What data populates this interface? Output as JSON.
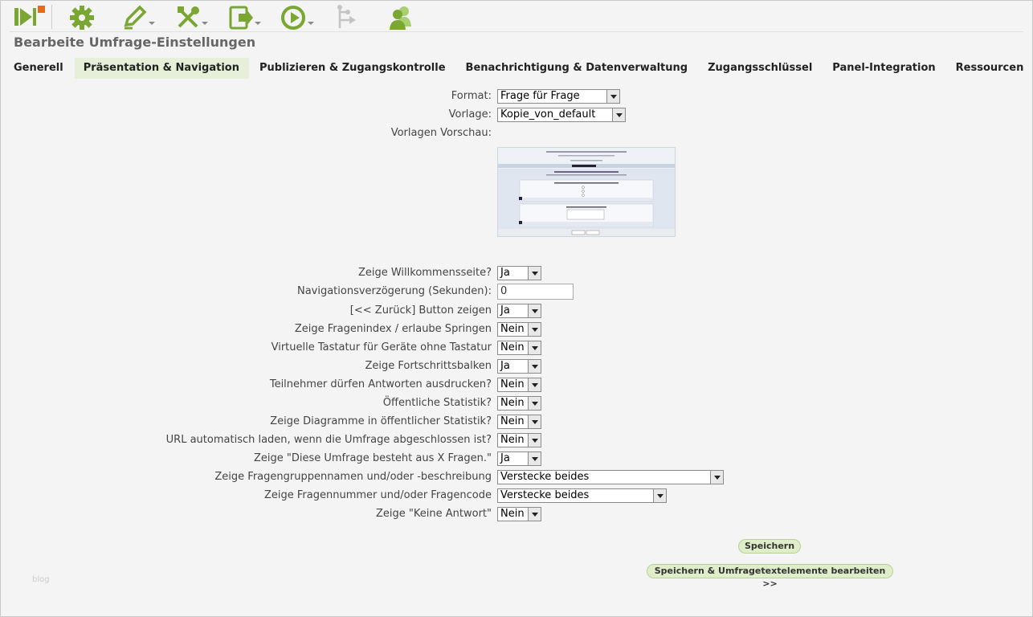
{
  "toolbar": {
    "items": [
      "limesurvey-logo-icon",
      "settings-gear-icon",
      "edit-pencil-icon",
      "tools-icon",
      "import-export-icon",
      "activate-icon",
      "survey-structure-icon",
      "participants-icon"
    ]
  },
  "page_title": "Bearbeite Umfrage-Einstellungen",
  "tabs": [
    {
      "label": "Generell"
    },
    {
      "label": "Präsentation & Navigation"
    },
    {
      "label": "Publizieren & Zugangskontrolle"
    },
    {
      "label": "Benachrichtigung & Datenverwaltung"
    },
    {
      "label": "Zugangsschlüssel"
    },
    {
      "label": "Panel-Integration"
    },
    {
      "label": "Ressourcen"
    }
  ],
  "form": {
    "format": {
      "label": "Format:",
      "value": "Frage für Frage"
    },
    "vorlage": {
      "label": "Vorlage:",
      "value": "Kopie_von_default"
    },
    "vorschau": {
      "label": "Vorlagen Vorschau:"
    },
    "welcome": {
      "label": "Zeige Willkommensseite?",
      "value": "Ja"
    },
    "navdelay": {
      "label": "Navigationsverzögerung (Sekunden):",
      "value": "0"
    },
    "backbutton": {
      "label": "[<< Zurück] Button zeigen",
      "value": "Ja"
    },
    "qindex": {
      "label": "Zeige Fragenindex / erlaube Springen",
      "value": "Nein"
    },
    "keyboard": {
      "label": "Virtuelle Tastatur für Geräte ohne Tastatur",
      "value": "Nein"
    },
    "progress": {
      "label": "Zeige Fortschrittsbalken",
      "value": "Ja"
    },
    "print": {
      "label": "Teilnehmer dürfen Antworten ausdrucken?",
      "value": "Nein"
    },
    "publicstats": {
      "label": "Öffentliche Statistik?",
      "value": "Nein"
    },
    "publicgraphs": {
      "label": "Zeige Diagramme in öffentlicher Statistik?",
      "value": "Nein"
    },
    "autoredirect": {
      "label": "URL automatisch laden, wenn die Umfrage abgeschlossen ist?",
      "value": "Nein"
    },
    "xquestions": {
      "label": "Zeige \"Diese Umfrage besteht aus X Fragen.\"",
      "value": "Ja"
    },
    "groupinfo": {
      "label": "Zeige Fragengruppennamen und/oder -beschreibung",
      "value": "Verstecke beides"
    },
    "qnumcode": {
      "label": "Zeige Fragennummer und/oder Fragencode",
      "value": "Verstecke beides"
    },
    "noanswer": {
      "label": "Zeige \"Keine Antwort\"",
      "value": "Nein"
    }
  },
  "buttons": {
    "save": "Speichern",
    "save_edit": "Speichern & Umfragetextelemente bearbeiten >>"
  },
  "footer_watermark": "blog"
}
